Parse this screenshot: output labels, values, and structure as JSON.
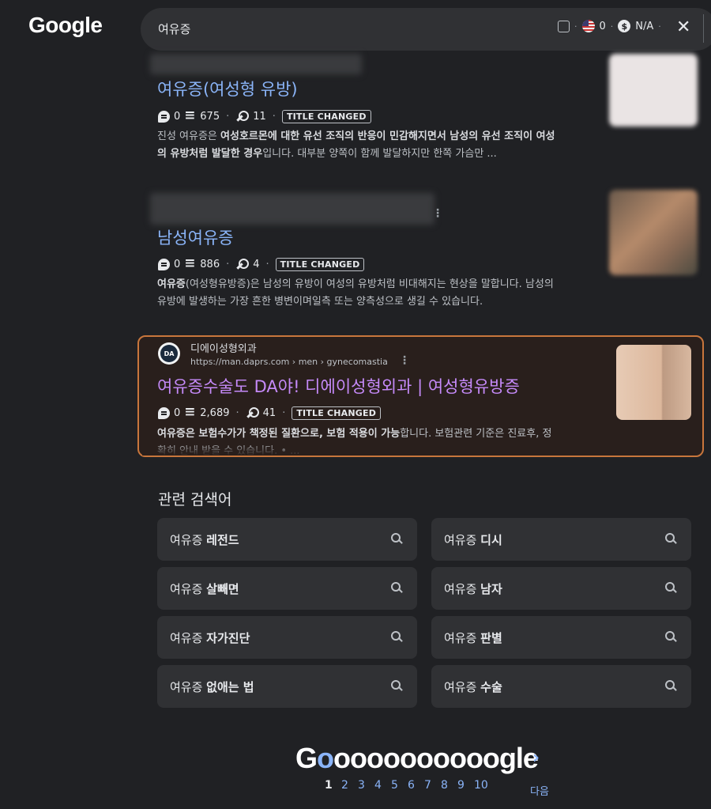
{
  "logo": "Google",
  "search": {
    "query": "여유증",
    "flag_count": "0",
    "price_label": "N/A"
  },
  "results": [
    {
      "title": "여유증(여성형 유방)",
      "comments": "0",
      "lines": "675",
      "keywords": "11",
      "tag": "TITLE CHANGED",
      "snippet_lines": [
        [
          {
            "t": "진성 여유증은 ",
            "b": false
          },
          {
            "t": "여성호르몬에 대한 유선 조직의 반응이 민감해지면서 남성의 유선 조직이 여성",
            "b": true
          }
        ],
        [
          {
            "t": "의 유방처럼 발달한 경우",
            "b": true
          },
          {
            "t": "입니다. 대부분 양쪽이 함께 발달하지만 한쪽 가슴만 ...",
            "b": false
          }
        ]
      ]
    },
    {
      "title": "남성여유증",
      "comments": "0",
      "lines": "886",
      "keywords": "4",
      "tag": "TITLE CHANGED",
      "snippet_lines": [
        [
          {
            "t": "여유증",
            "b": true
          },
          {
            "t": "(여성형유방증)은 남성의 유방이 여성의 유방처럼 비대해지는 현상을 말합니다. 남성의",
            "b": false
          }
        ],
        [
          {
            "t": "유방에 발생하는 가장 흔한 병변이며일측 또는 양측성으로 생길 수 있습니다.",
            "b": false
          }
        ]
      ]
    },
    {
      "site_icon": "DA",
      "site_name": "디에이성형외과",
      "url": "https://man.daprs.com › men › gynecomastia",
      "title": "여유증수술도 DA야! 디에이성형외과 | 여성형유방증",
      "comments": "0",
      "lines": "2,689",
      "keywords": "41",
      "tag": "TITLE CHANGED",
      "snippet_lines": [
        [
          {
            "t": "여유증은 보험수가가 책정된 질환으로, 보험 적용이 가능",
            "b": true
          },
          {
            "t": "합니다. 보험관련 기준은 진료후, 정",
            "b": false
          }
        ],
        [
          {
            "t": "확히 안내 받을 수 있습니다. • ...",
            "b": false
          }
        ]
      ]
    }
  ],
  "related": {
    "heading": "관련 검색어",
    "items": [
      {
        "prefix": "여유증 ",
        "bold": "레전드"
      },
      {
        "prefix": "여유증 ",
        "bold": "디시"
      },
      {
        "prefix": "여유증 ",
        "bold": "살빼면"
      },
      {
        "prefix": "여유증 ",
        "bold": "남자"
      },
      {
        "prefix": "여유증 ",
        "bold": "자가진단"
      },
      {
        "prefix": "여유증 ",
        "bold": "판별"
      },
      {
        "prefix": "여유증 ",
        "bold": "없애는 법"
      },
      {
        "prefix": "여유증 ",
        "bold": "수술"
      }
    ]
  },
  "pagination": {
    "logo_start": "G",
    "logo_blue_o": "o",
    "logo_rest": "oooooooooogle",
    "pages": [
      "1",
      "2",
      "3",
      "4",
      "5",
      "6",
      "7",
      "8",
      "9",
      "10"
    ],
    "current": "1",
    "next_label": "다음",
    "next_arrow": "›"
  },
  "colors": {
    "background": "#202124",
    "link": "#8ab4f8",
    "visited_link": "#c58af9",
    "highlight_border": "#c8763c"
  }
}
